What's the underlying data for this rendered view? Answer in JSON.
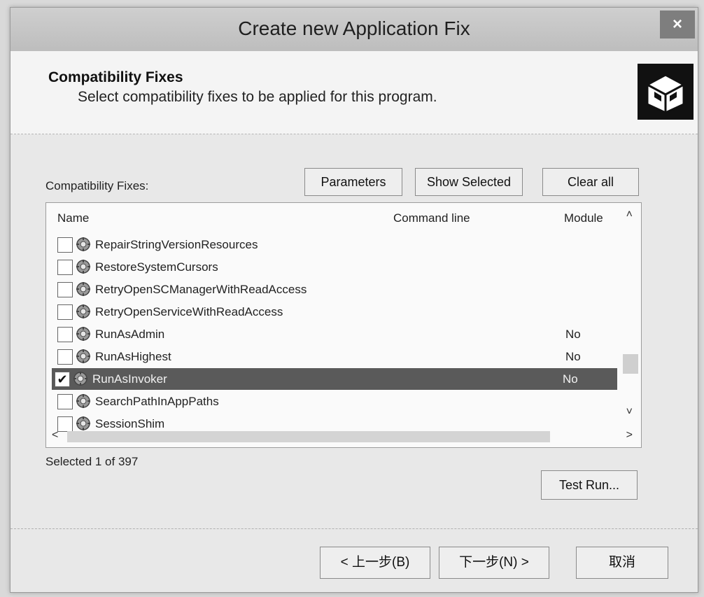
{
  "window": {
    "title": "Create new Application Fix",
    "close_label": "×"
  },
  "header": {
    "title": "Compatibility Fixes",
    "subtitle": "Select compatibility fixes to be applied for this program."
  },
  "fixes": {
    "label": "Compatibility Fixes:",
    "buttons": {
      "parameters": "Parameters",
      "show_selected": "Show Selected",
      "clear_all": "Clear all"
    },
    "columns": {
      "name": "Name",
      "command_line": "Command line",
      "module": "Module"
    },
    "rows": [
      {
        "name": "RepairStringVersionResources",
        "module": "",
        "checked": false
      },
      {
        "name": "RestoreSystemCursors",
        "module": "",
        "checked": false
      },
      {
        "name": "RetryOpenSCManagerWithReadAccess",
        "module": "",
        "checked": false
      },
      {
        "name": "RetryOpenServiceWithReadAccess",
        "module": "",
        "checked": false
      },
      {
        "name": "RunAsAdmin",
        "module": "No",
        "checked": false
      },
      {
        "name": "RunAsHighest",
        "module": "No",
        "checked": false
      },
      {
        "name": "RunAsInvoker",
        "module": "No",
        "checked": true,
        "selected": true
      },
      {
        "name": "SearchPathInAppPaths",
        "module": "",
        "checked": false
      },
      {
        "name": "SessionShim",
        "module": "",
        "checked": false
      }
    ],
    "check_mark": "✔",
    "scroll": {
      "up": "˄",
      "down": "˅",
      "left": "<",
      "right": ">"
    },
    "selected_count": "Selected 1 of 397",
    "test_run": "Test Run..."
  },
  "footer": {
    "back": "< 上一步(B)",
    "next": "下一步(N) >",
    "cancel": "取消"
  }
}
